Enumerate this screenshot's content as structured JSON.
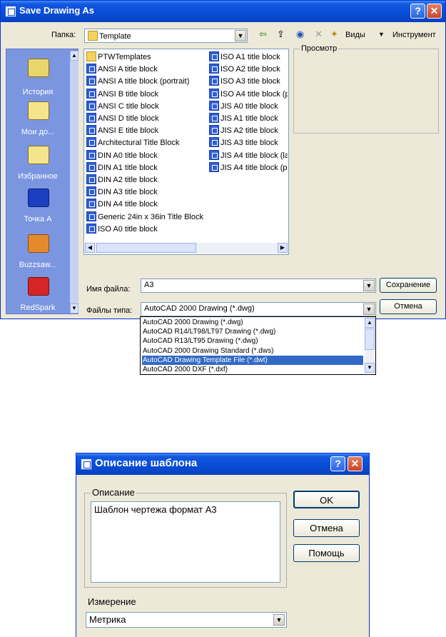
{
  "save_dialog": {
    "title": "Save Drawing As",
    "folder_label": "Папка:",
    "folder_value": "Template",
    "toolbar": {
      "views_label": "Виды",
      "tools_label": "Инструмент"
    },
    "places": [
      {
        "label": "История",
        "icon": "history-icon",
        "color": "#e8d66a"
      },
      {
        "label": "Мои до...",
        "icon": "my-documents-icon",
        "color": "#f3e58c"
      },
      {
        "label": "Избранное",
        "icon": "favorites-icon",
        "color": "#f3e58c"
      },
      {
        "label": "Точка А",
        "icon": "network-place-icon",
        "color": "#1b3fbf"
      },
      {
        "label": "Buzzsaw...",
        "icon": "buzzsaw-icon",
        "color": "#e58a2c"
      },
      {
        "label": "RedSpark",
        "icon": "redspark-icon",
        "color": "#d52525"
      }
    ],
    "files_col1": [
      "PTWTemplates",
      "ANSI A title block",
      "ANSI A title block (portrait)",
      "ANSI B title block",
      "ANSI C title block",
      "ANSI D title block",
      "ANSI E title block",
      "Architectural Title Block",
      "DIN A0 title block",
      "DIN A1 title block",
      "DIN A2 title block",
      "DIN A3 title block",
      "DIN A4 title block",
      "Generic 24in x 36in Title Block",
      "ISO A0 title block"
    ],
    "files_col2": [
      "ISO A1 title block",
      "ISO A2 title block",
      "ISO A3 title block",
      "ISO A4 title block (p",
      "JIS A0 title block",
      "JIS A1 title block",
      "JIS A2 title block",
      "JIS A3 title block",
      "JIS A4 title block (la",
      "JIS A4 title block (p"
    ],
    "preview_label": "Просмотр",
    "filename_label": "Имя файла:",
    "filename_value": "A3",
    "filetype_label": "Файлы типа:",
    "filetype_value": "AutoCAD 2000 Drawing (*.dwg)",
    "save_button": "Сохранение",
    "cancel_button": "Отмена",
    "filetype_options": [
      "AutoCAD 2000 Drawing (*.dwg)",
      "AutoCAD R14/LT98/LT97 Drawing (*.dwg)",
      "AutoCAD R13/LT95 Drawing (*.dwg)",
      "AutoCAD 2000 Drawing Standard (*.dws)",
      "AutoCAD Drawing Template File (*.dwt)",
      "AutoCAD 2000 DXF (*.dxf)"
    ],
    "selected_option_index": 4
  },
  "template_dialog": {
    "title": "Описание шаблона",
    "description_label": "Описание",
    "description_text": "Шаблон чертежа формат А3",
    "ok_button": "OK",
    "cancel_button": "Отмена",
    "help_button": "Помощь",
    "measurement_label": "Измерение",
    "measurement_value": "Метрика"
  }
}
